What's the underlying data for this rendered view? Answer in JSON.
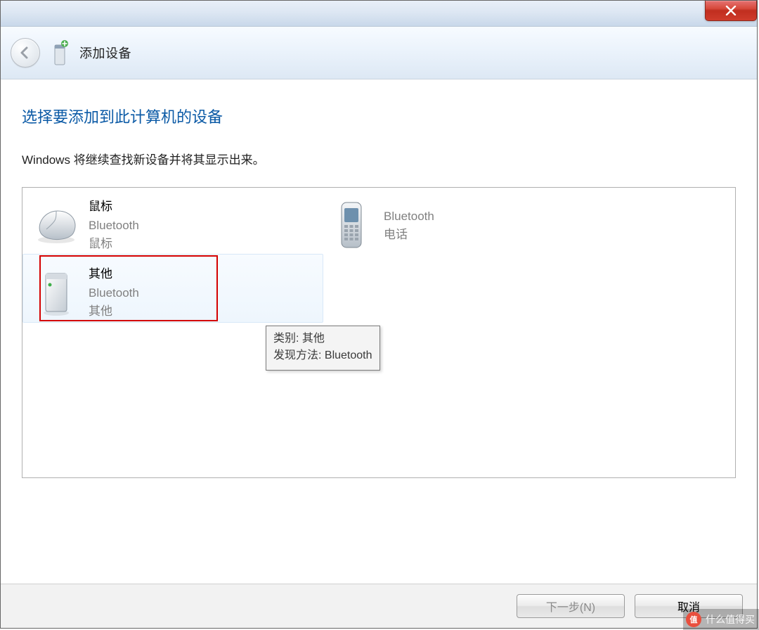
{
  "header": {
    "title": "添加设备"
  },
  "page": {
    "heading": "选择要添加到此计算机的设备",
    "subtitle": "Windows 将继续查找新设备并将其显示出来。"
  },
  "devices": {
    "d0": {
      "name": "鼠标",
      "tech": "Bluetooth",
      "category": "鼠标"
    },
    "d1": {
      "name": "",
      "tech": "Bluetooth",
      "category": "电话"
    },
    "d2": {
      "name": "其他",
      "tech": "Bluetooth",
      "category": "其他"
    }
  },
  "tooltip": {
    "line1": "类别: 其他",
    "line2": "发现方法: Bluetooth"
  },
  "footer": {
    "next": "下一步(N)",
    "cancel": "取消"
  },
  "watermark": {
    "badge": "值",
    "text": "什么值得买"
  }
}
